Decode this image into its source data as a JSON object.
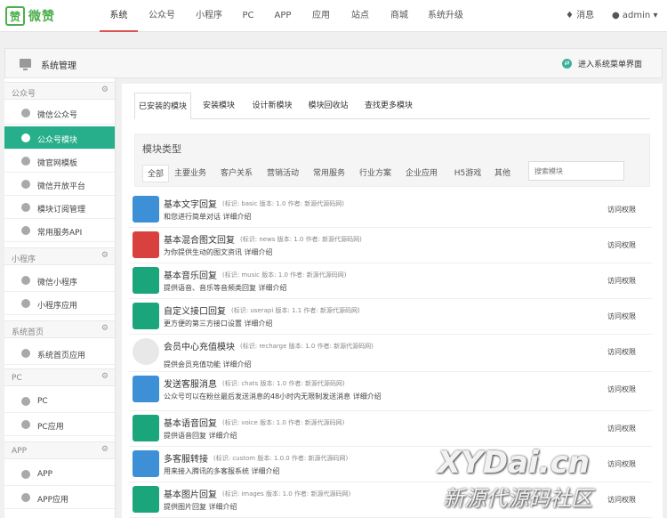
{
  "nav": {
    "logo_text": "微赞",
    "items": [
      "系统",
      "公众号",
      "小程序",
      "PC",
      "APP",
      "应用",
      "站点",
      "商城",
      "系统升级"
    ],
    "messages": "消息",
    "user": "admin"
  },
  "header": {
    "title": "系统管理",
    "switch_label": "进入系统菜单界面"
  },
  "sidebar": {
    "groups": [
      {
        "label": "公众号",
        "items": [
          "微信公众号",
          "公众号模块",
          "微官网模板",
          "微信开放平台",
          "模块订阅管理",
          "常用服务API"
        ]
      },
      {
        "label": "小程序",
        "items": [
          "微信小程序",
          "小程序应用"
        ]
      },
      {
        "label": "系统首页",
        "items": [
          "系统首页应用"
        ]
      },
      {
        "label": "PC",
        "items": [
          "PC",
          "PC应用"
        ]
      },
      {
        "label": "APP",
        "items": [
          "APP",
          "APP应用"
        ]
      }
    ]
  },
  "tabs": [
    "已安装的模块",
    "安装模块",
    "设计新模块",
    "模块回收站",
    "查找更多模块"
  ],
  "module_types": {
    "title": "模块类型",
    "filters": [
      "全部",
      "主要业务",
      "客户关系",
      "营销活动",
      "常用服务",
      "行业方案",
      "企业应用",
      "H5游戏",
      "其他"
    ],
    "search_placeholder": "搜索模块"
  },
  "modules": [
    {
      "name": "基本文字回复",
      "meta": "(标识: basic  版本: 1.0  作者: 新源代源码网)",
      "desc": "和您进行简单对话 详细介绍",
      "perm": "访问权限",
      "icon": "book-icon",
      "color": "#3d8fd6"
    },
    {
      "name": "基本混合图文回复",
      "meta": "(标识: news  版本: 1.0  作者: 新源代源码网)",
      "desc": "为你提供生动的图文资讯 详细介绍",
      "perm": "访问权限",
      "icon": "image-icon",
      "color": "#d9413e"
    },
    {
      "name": "基本音乐回复",
      "meta": "(标识: music  版本: 1.0  作者: 新源代源码网)",
      "desc": "提供语音、音乐等音频类回复 详细介绍",
      "perm": "访问权限",
      "icon": "speaker-icon",
      "color": "#1aa57a"
    },
    {
      "name": "自定义接口回复",
      "meta": "(标识: userapi  版本: 1.1  作者: 新源代源码网)",
      "desc": "更方便的第三方接口设置 详细介绍",
      "perm": "访问权限",
      "icon": "tree-icon",
      "color": "#1aa57a"
    },
    {
      "name": "会员中心充值模块",
      "meta": "(标识: recharge  版本: 1.0  作者: 新源代源码网)",
      "desc": "提供会员充值功能 详细介绍",
      "perm": "访问权限",
      "icon": "recharge-icon",
      "color": "#e8e8e8"
    },
    {
      "name": "发送客服消息",
      "meta": "(标识: chats  版本: 1.0  作者: 新源代源码网)",
      "desc": "公众号可以在粉丝最后发送消息的48小时内无限制发送消息 详细介绍",
      "perm": "访问权限",
      "icon": "book-icon",
      "color": "#3d8fd6"
    },
    {
      "name": "基本语音回复",
      "meta": "(标识: voice  版本: 1.0  作者: 新源代源码网)",
      "desc": "提供语音回复 详细介绍",
      "perm": "访问权限",
      "icon": "speaker-icon",
      "color": "#1aa57a"
    },
    {
      "name": "多客服转接",
      "meta": "(标识: custom  版本: 1.0.0  作者: 新源代源码网)",
      "desc": "用来接入腾讯的多客服系统 详细介绍",
      "perm": "访问权限",
      "icon": "book-icon",
      "color": "#3d8fd6"
    },
    {
      "name": "基本图片回复",
      "meta": "(标识: images  版本: 1.0  作者: 新源代源码网)",
      "desc": "提供图片回复 详细介绍",
      "perm": "访问权限",
      "icon": "speaker-icon",
      "color": "#1aa57a"
    }
  ],
  "watermark": {
    "line1": "XYDai.cn",
    "line2": "新源代源码社区"
  }
}
